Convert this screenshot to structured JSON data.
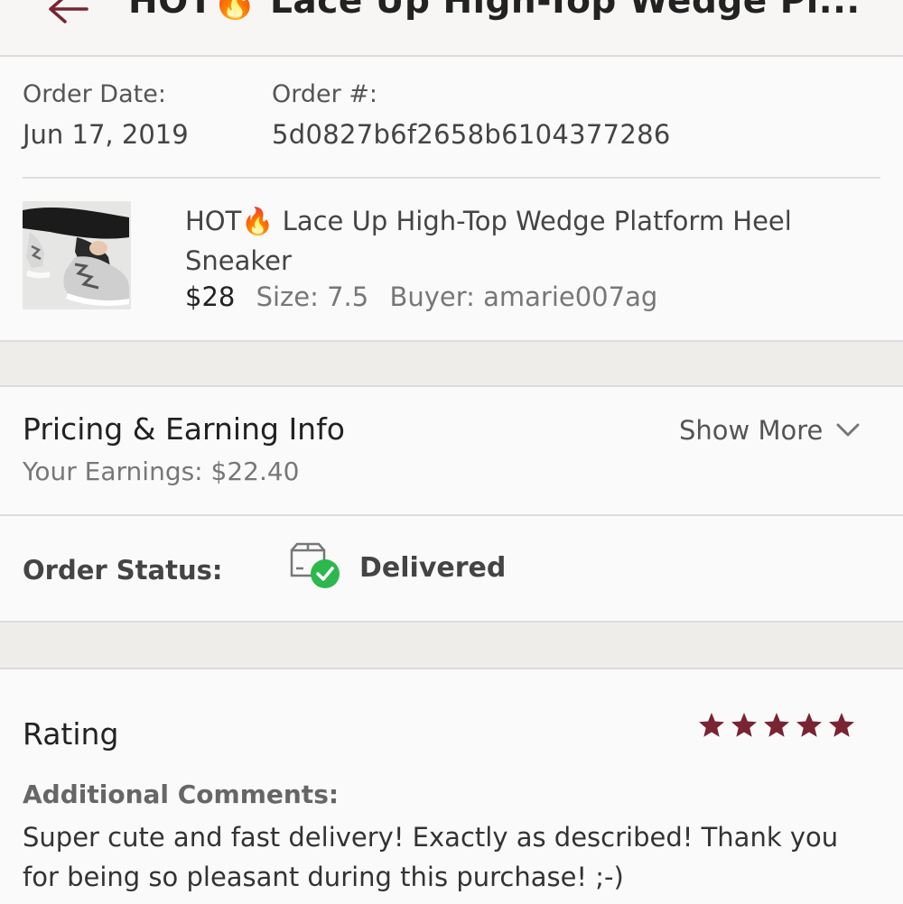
{
  "header": {
    "title": "HOT🔥 Lace Up High-Top Wedge Pl..."
  },
  "order": {
    "date_label": "Order Date:",
    "date_value": "Jun 17, 2019",
    "number_label": "Order #:",
    "number_value": "5d0827b6f2658b6104377286"
  },
  "product": {
    "title": "HOT🔥 Lace Up High-Top Wedge Platform Heel Sneaker",
    "price": "$28",
    "size": "Size: 7.5",
    "buyer": "Buyer: amarie007ag",
    "image": "sneaker-photo"
  },
  "pricing": {
    "title": "Pricing & Earning Info",
    "earnings": "Your Earnings: $22.40",
    "show_more": "Show More",
    "show_more_icon": "chevron-down-icon"
  },
  "status": {
    "label": "Order Status:",
    "value": "Delivered",
    "icon": "box-delivered-icon"
  },
  "rating": {
    "label": "Rating",
    "stars": 5,
    "max_stars": 5,
    "star_color": "#7a2333",
    "comments_label": "Additional Comments:",
    "comments_text": "Super cute and fast delivery! Exactly as described! Thank you for being so pleasant during this purchase! ;-)"
  },
  "colors": {
    "accent": "#7a2333",
    "success": "#2db84d",
    "band": "#efedea"
  }
}
